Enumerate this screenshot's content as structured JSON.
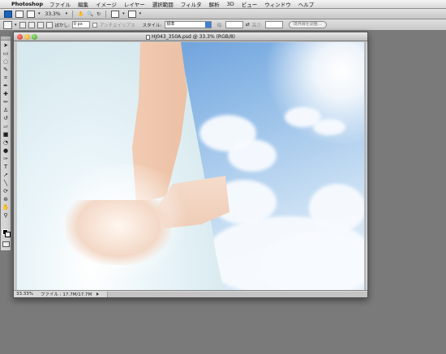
{
  "menubar": {
    "app_name": "Photoshop",
    "items": [
      "ファイル",
      "編集",
      "イメージ",
      "レイヤー",
      "選択範囲",
      "フィルタ",
      "解析",
      "3D",
      "ビュー",
      "ウィンドウ",
      "ヘルプ"
    ]
  },
  "appbar": {
    "zoom": "33.3%"
  },
  "options": {
    "feather_label": "ぼかし:",
    "feather_value": "0 px",
    "antialias_label": "アンチエイリアス",
    "style_label": "スタイル:",
    "style_value": "標準",
    "width_label": "幅:",
    "height_label": "高さ:",
    "refine_button": "境界線を調整..."
  },
  "document": {
    "title": "HJ043_350A.psd @ 33.3% (RGB/8)",
    "status_zoom": "33.33%",
    "status_file": "ファイル : 17.7M/17.7M"
  }
}
